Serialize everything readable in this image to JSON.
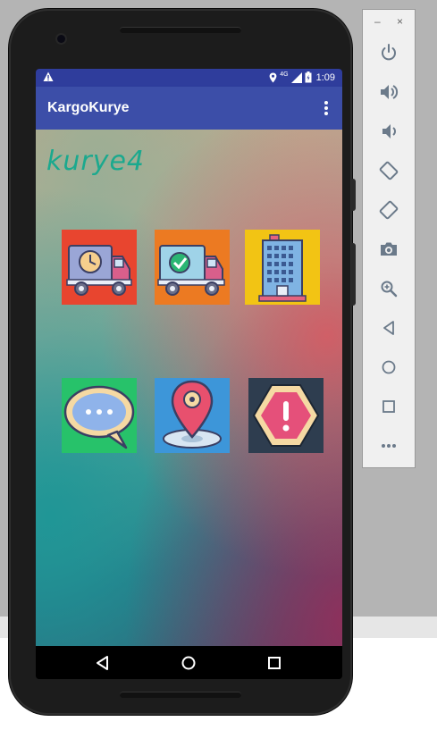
{
  "window": {
    "minimize_label": "–",
    "close_label": "×"
  },
  "statusbar": {
    "time": "1:09",
    "network": "4G",
    "icons": [
      "warning-icon",
      "location-icon",
      "signal-icon",
      "battery-icon"
    ]
  },
  "appbar": {
    "title": "KargoKurye",
    "overflow_icon": "more-vert-icon"
  },
  "content": {
    "username": "kurye4",
    "tiles": [
      {
        "icon": "truck-clock-icon",
        "bg": "#e8452f"
      },
      {
        "icon": "truck-check-icon",
        "bg": "#ec7a22"
      },
      {
        "icon": "building-icon",
        "bg": "#f2c414"
      },
      {
        "icon": "chat-bubble-icon",
        "bg": "#27c26a"
      },
      {
        "icon": "map-pin-icon",
        "bg": "#3d96d9"
      },
      {
        "icon": "warning-hexagon-icon",
        "bg": "#2e3d4f"
      }
    ]
  },
  "navbar": {
    "buttons": [
      "back-icon",
      "home-icon",
      "recents-icon"
    ]
  },
  "emulator_panel": {
    "buttons": [
      "power-icon",
      "volume-up-icon",
      "volume-down-icon",
      "rotate-left-icon",
      "rotate-right-icon",
      "camera-icon",
      "zoom-icon",
      "back-icon",
      "home-icon",
      "overview-icon",
      "more-icon"
    ]
  }
}
